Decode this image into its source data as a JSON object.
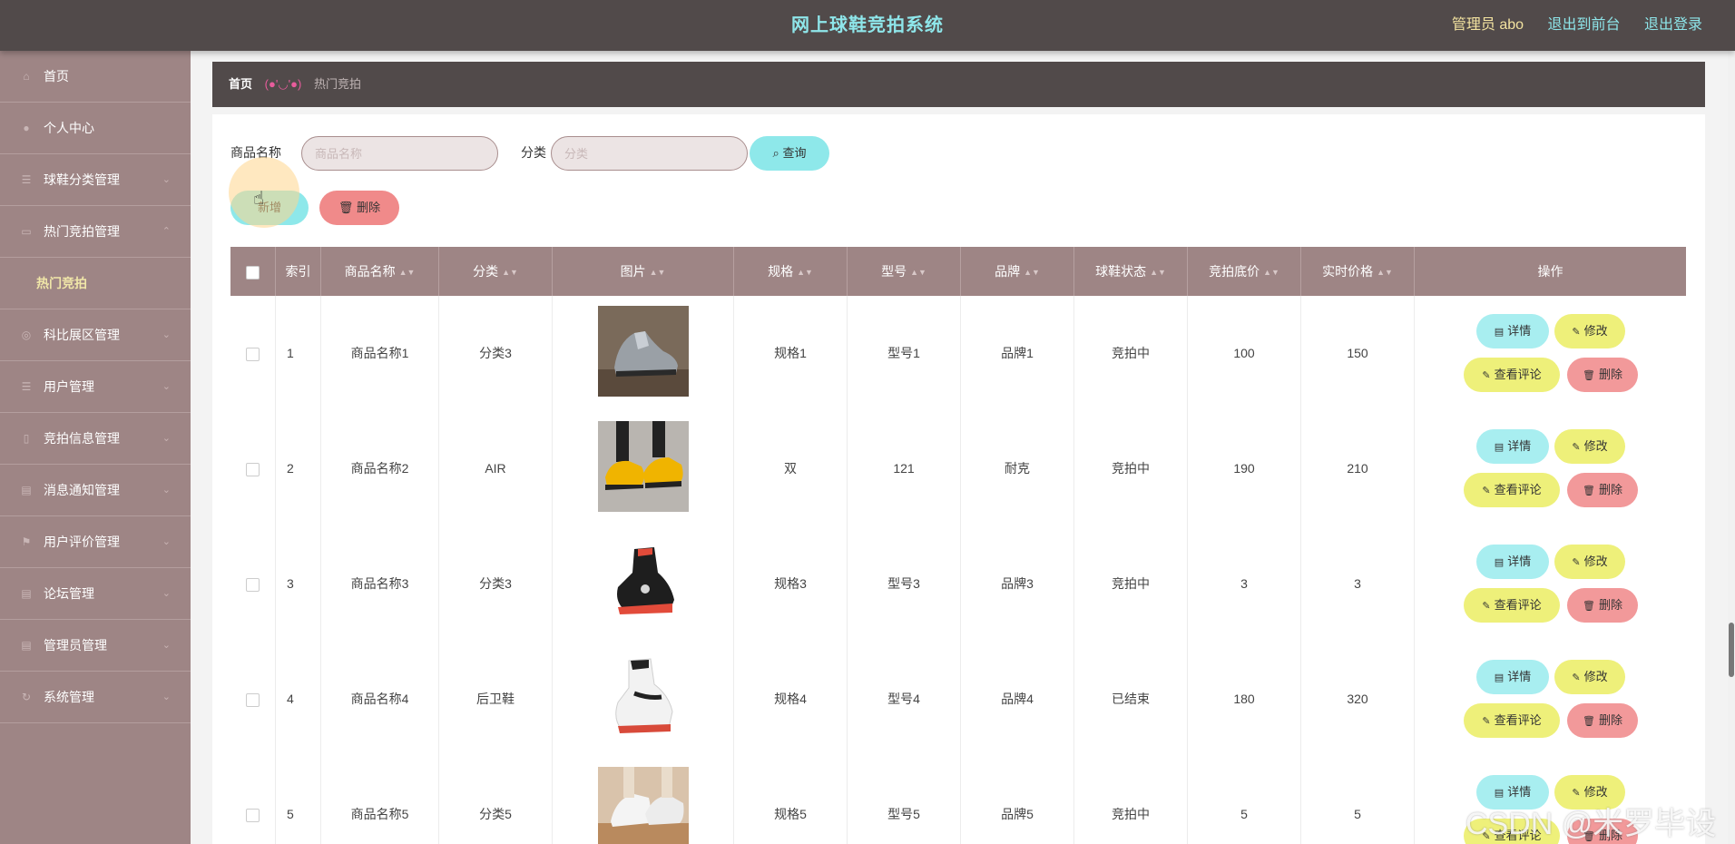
{
  "header": {
    "title": "网上球鞋竞拍系统",
    "admin_label": "管理员 abo",
    "link_front": "退出到前台",
    "link_logout": "退出登录"
  },
  "sidebar": {
    "items": [
      {
        "label": "首页",
        "icon": "home-icon"
      },
      {
        "label": "个人中心",
        "icon": "user-icon"
      },
      {
        "label": "球鞋分类管理",
        "icon": "list-icon"
      },
      {
        "label": "热门竞拍管理",
        "icon": "folder-icon"
      },
      {
        "label": "科比展区管理",
        "icon": "target-icon"
      },
      {
        "label": "用户管理",
        "icon": "list-icon"
      },
      {
        "label": "竞拍信息管理",
        "icon": "doc-icon"
      },
      {
        "label": "消息通知管理",
        "icon": "doc-icon"
      },
      {
        "label": "用户评价管理",
        "icon": "flag-icon"
      },
      {
        "label": "论坛管理",
        "icon": "doc-icon"
      },
      {
        "label": "管理员管理",
        "icon": "doc-icon"
      },
      {
        "label": "系统管理",
        "icon": "refresh-icon"
      }
    ],
    "active_sub": "热门竞拍"
  },
  "breadcrumb": {
    "home": "首页",
    "emoji": "(●'◡'●)",
    "current": "热门竞拍"
  },
  "search": {
    "name_label": "商品名称",
    "name_placeholder": "商品名称",
    "name_value": "",
    "category_label": "分类",
    "category_placeholder": "分类",
    "category_value": "",
    "query_button": "查询"
  },
  "actions": {
    "add_button": "新增",
    "delete_button": "删除"
  },
  "table": {
    "headers": {
      "index": "索引",
      "name": "商品名称",
      "category": "分类",
      "image": "图片",
      "spec": "规格",
      "model": "型号",
      "brand": "品牌",
      "status": "球鞋状态",
      "base_price": "竞拍底价",
      "current_price": "实时价格",
      "ops": "操作"
    },
    "op_labels": {
      "detail": "详情",
      "edit": "修改",
      "review": "查看评论",
      "delete": "删除"
    },
    "rows": [
      {
        "index": "1",
        "name": "商品名称1",
        "category": "分类3",
        "spec": "规格1",
        "model": "型号1",
        "brand": "品牌1",
        "status": "竞拍中",
        "base_price": "100",
        "current_price": "150"
      },
      {
        "index": "2",
        "name": "商品名称2",
        "category": "AIR",
        "spec": "双",
        "model": "121",
        "brand": "耐克",
        "status": "竞拍中",
        "base_price": "190",
        "current_price": "210"
      },
      {
        "index": "3",
        "name": "商品名称3",
        "category": "分类3",
        "spec": "规格3",
        "model": "型号3",
        "brand": "品牌3",
        "status": "竞拍中",
        "base_price": "3",
        "current_price": "3"
      },
      {
        "index": "4",
        "name": "商品名称4",
        "category": "后卫鞋",
        "spec": "规格4",
        "model": "型号4",
        "brand": "品牌4",
        "status": "已结束",
        "base_price": "180",
        "current_price": "320"
      },
      {
        "index": "5",
        "name": "商品名称5",
        "category": "分类5",
        "spec": "规格5",
        "model": "型号5",
        "brand": "品牌5",
        "status": "竞拍中",
        "base_price": "5",
        "current_price": "5"
      }
    ]
  },
  "watermark": "CSDN @米罗毕设",
  "colors": {
    "topbar": "#514a4a",
    "sidebar": "#9e8585",
    "title_accent": "#8ee6ea",
    "active_sub": "#f0e6a8",
    "btn_cyan": "#8ee8ea",
    "btn_yellow": "#eef07a",
    "btn_red": "#f08a8a"
  }
}
